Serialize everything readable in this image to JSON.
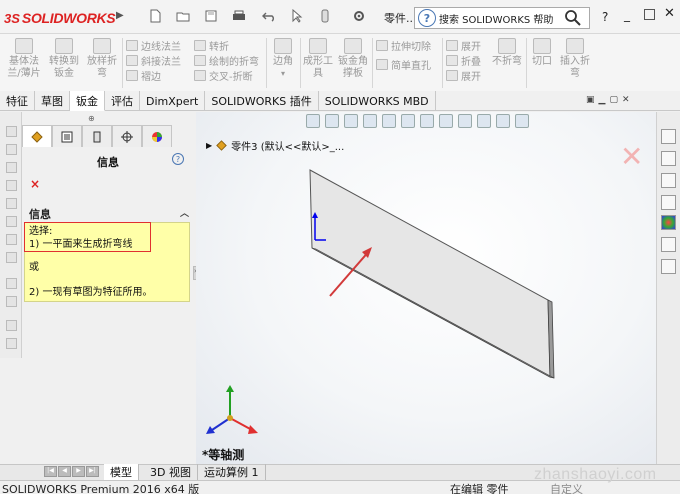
{
  "app": {
    "logo_text": "SOLIDWORKS",
    "logo_prefix": "3S"
  },
  "titlebar": {
    "menu_label": "零件...",
    "search_label": "搜索 SOLIDWORKS 帮助",
    "help": "?"
  },
  "ribbon": {
    "large_buttons": [
      {
        "label1": "基体法",
        "label2": "兰/薄片"
      },
      {
        "label1": "转换到",
        "label2": "钣金"
      },
      {
        "label1": "放样折",
        "label2": "弯"
      },
      {
        "label1": "边角",
        "label2": ""
      },
      {
        "label1": "成形工",
        "label2": "具"
      },
      {
        "label1": "钣金角",
        "label2": "撑板"
      },
      {
        "label1": "折叠",
        "label2": ""
      },
      {
        "label1": "不折弯",
        "label2": ""
      },
      {
        "label1": "切口",
        "label2": ""
      },
      {
        "label1": "插入折",
        "label2": "弯"
      }
    ],
    "small_buttons": [
      "边线法兰",
      "斜接法兰",
      "褶边",
      "转折",
      "绘制的折弯",
      "交叉-折断",
      "拉伸切除",
      "简单直孔",
      "展开",
      "展开"
    ]
  },
  "tabs": [
    "特征",
    "草图",
    "钣金",
    "评估",
    "DimXpert",
    "SOLIDWORKS 插件",
    "SOLIDWORKS MBD"
  ],
  "active_tab": "钣金",
  "panel": {
    "title": "信息",
    "help": "?",
    "close": "×",
    "section_title": "信息",
    "msg_line1": "选择:",
    "msg_line2": "1) 一平面来生成折弯线",
    "msg_line3": "或",
    "msg_line4": "2) 一现有草图为特征所用。"
  },
  "viewport": {
    "tree_label": "零件3 (默认<<默认>_...",
    "view_label": "*等轴测",
    "ghost": "✕"
  },
  "bottom_tabs": [
    "模型",
    "3D 视图",
    "运动算例 1"
  ],
  "status": {
    "left": "SOLIDWORKS Premium 2016 x64 版",
    "edit": "在编辑 零件",
    "custom": "自定义"
  },
  "watermark": "zhanshaoyi.com",
  "colors": {
    "accent": "#d22222",
    "highlight": "#ffffa8",
    "tab_active": "#ffffff"
  }
}
